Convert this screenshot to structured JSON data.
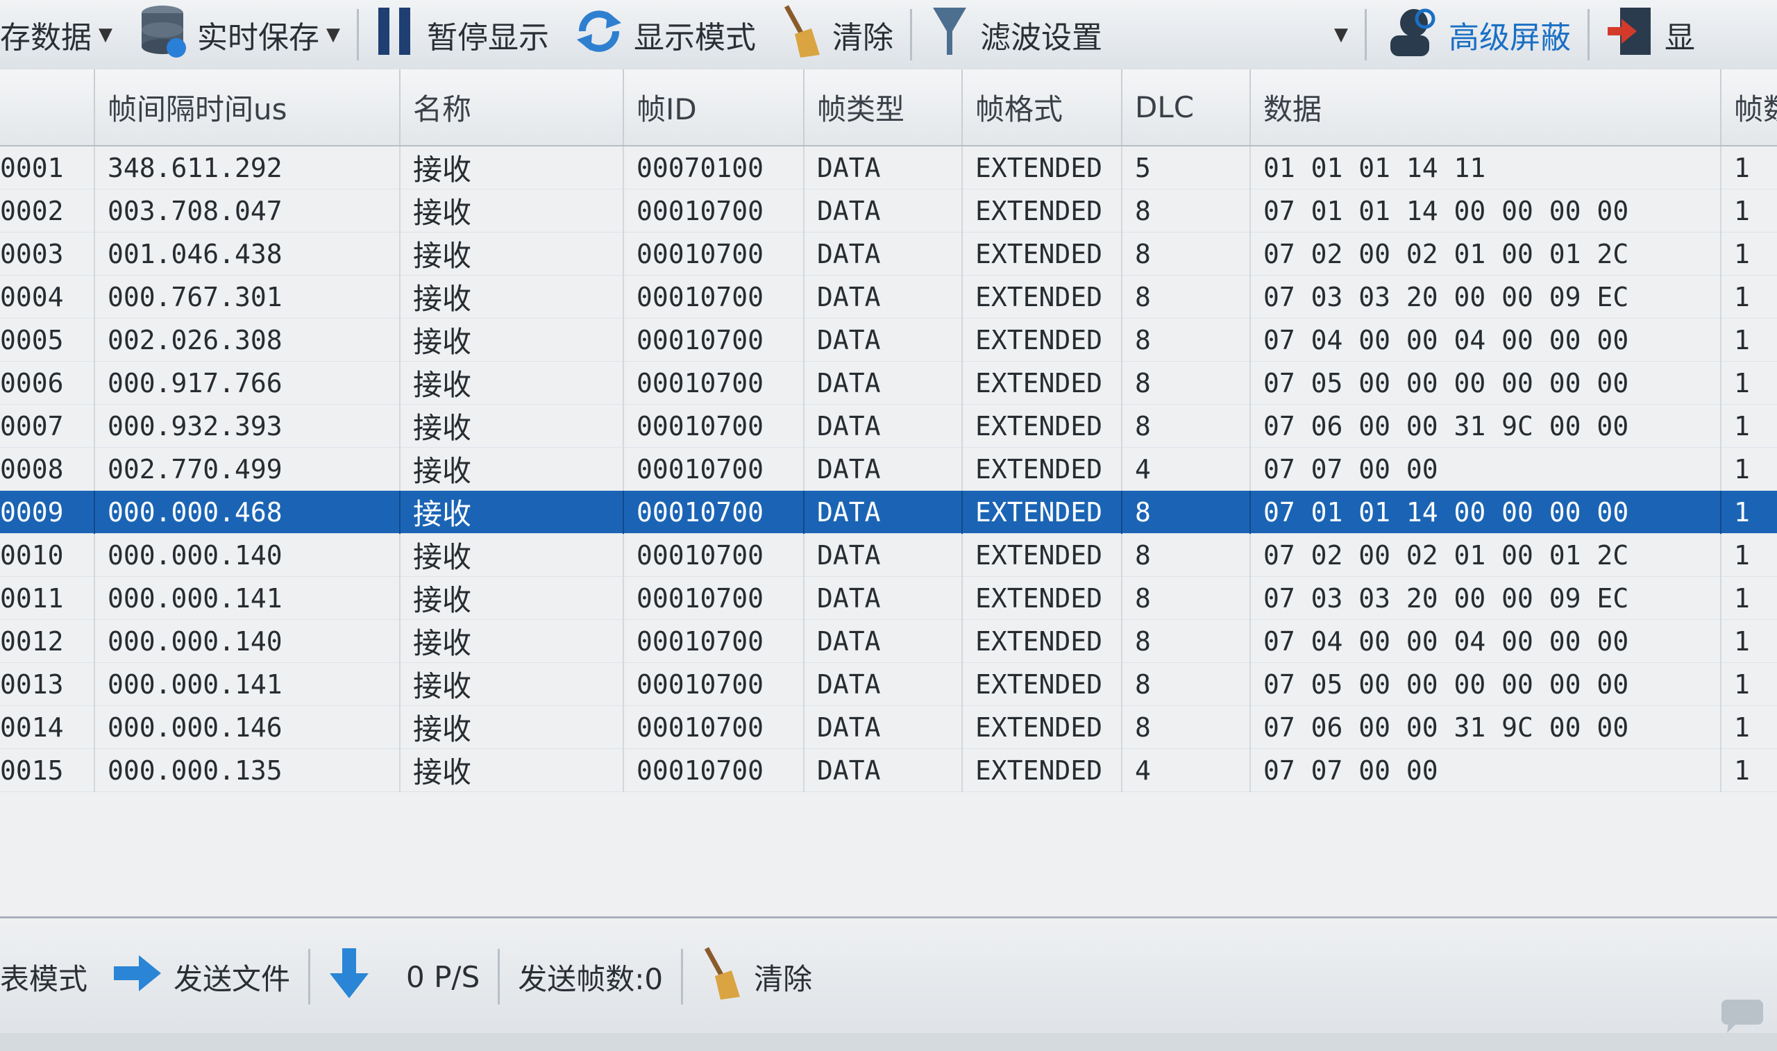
{
  "toolbar": {
    "save_data": "存数据",
    "realtime_save": "实时保存",
    "pause_display": "暂停显示",
    "display_mode": "显示模式",
    "clear": "清除",
    "filter_settings": "滤波设置",
    "advanced_mask": "高级屏蔽",
    "display_partial": "显"
  },
  "grid": {
    "columns": [
      "",
      "帧间隔时间us",
      "名称",
      "帧ID",
      "帧类型",
      "帧格式",
      "DLC",
      "数据",
      "帧数"
    ],
    "rows": [
      {
        "index": "0001",
        "interval": "348.611.292",
        "name": "接收",
        "frame_id": "00070100",
        "frame_type": "DATA",
        "frame_format": "EXTENDED",
        "dlc": "5",
        "data": "01 01 01 14 11",
        "last": "1"
      },
      {
        "index": "0002",
        "interval": "003.708.047",
        "name": "接收",
        "frame_id": "00010700",
        "frame_type": "DATA",
        "frame_format": "EXTENDED",
        "dlc": "8",
        "data": "07 01 01 14 00 00 00 00",
        "last": "1"
      },
      {
        "index": "0003",
        "interval": "001.046.438",
        "name": "接收",
        "frame_id": "00010700",
        "frame_type": "DATA",
        "frame_format": "EXTENDED",
        "dlc": "8",
        "data": "07 02 00 02 01 00 01 2C",
        "last": "1"
      },
      {
        "index": "0004",
        "interval": "000.767.301",
        "name": "接收",
        "frame_id": "00010700",
        "frame_type": "DATA",
        "frame_format": "EXTENDED",
        "dlc": "8",
        "data": "07 03 03 20 00 00 09 EC",
        "last": "1"
      },
      {
        "index": "0005",
        "interval": "002.026.308",
        "name": "接收",
        "frame_id": "00010700",
        "frame_type": "DATA",
        "frame_format": "EXTENDED",
        "dlc": "8",
        "data": "07 04 00 00 04 00 00 00",
        "last": "1"
      },
      {
        "index": "0006",
        "interval": "000.917.766",
        "name": "接收",
        "frame_id": "00010700",
        "frame_type": "DATA",
        "frame_format": "EXTENDED",
        "dlc": "8",
        "data": "07 05 00 00 00 00 00 00",
        "last": "1"
      },
      {
        "index": "0007",
        "interval": "000.932.393",
        "name": "接收",
        "frame_id": "00010700",
        "frame_type": "DATA",
        "frame_format": "EXTENDED",
        "dlc": "8",
        "data": "07 06 00 00 31 9C 00 00",
        "last": "1"
      },
      {
        "index": "0008",
        "interval": "002.770.499",
        "name": "接收",
        "frame_id": "00010700",
        "frame_type": "DATA",
        "frame_format": "EXTENDED",
        "dlc": "4",
        "data": "07 07 00 00",
        "last": "1"
      },
      {
        "index": "0009",
        "interval": "000.000.468",
        "name": "接收",
        "frame_id": "00010700",
        "frame_type": "DATA",
        "frame_format": "EXTENDED",
        "dlc": "8",
        "data": "07 01 01 14 00 00 00 00",
        "last": "1"
      },
      {
        "index": "0010",
        "interval": "000.000.140",
        "name": "接收",
        "frame_id": "00010700",
        "frame_type": "DATA",
        "frame_format": "EXTENDED",
        "dlc": "8",
        "data": "07 02 00 02 01 00 01 2C",
        "last": "1"
      },
      {
        "index": "0011",
        "interval": "000.000.141",
        "name": "接收",
        "frame_id": "00010700",
        "frame_type": "DATA",
        "frame_format": "EXTENDED",
        "dlc": "8",
        "data": "07 03 03 20 00 00 09 EC",
        "last": "1"
      },
      {
        "index": "0012",
        "interval": "000.000.140",
        "name": "接收",
        "frame_id": "00010700",
        "frame_type": "DATA",
        "frame_format": "EXTENDED",
        "dlc": "8",
        "data": "07 04 00 00 04 00 00 00",
        "last": "1"
      },
      {
        "index": "0013",
        "interval": "000.000.141",
        "name": "接收",
        "frame_id": "00010700",
        "frame_type": "DATA",
        "frame_format": "EXTENDED",
        "dlc": "8",
        "data": "07 05 00 00 00 00 00 00",
        "last": "1"
      },
      {
        "index": "0014",
        "interval": "000.000.146",
        "name": "接收",
        "frame_id": "00010700",
        "frame_type": "DATA",
        "frame_format": "EXTENDED",
        "dlc": "8",
        "data": "07 06 00 00 31 9C 00 00",
        "last": "1"
      },
      {
        "index": "0015",
        "interval": "000.000.135",
        "name": "接收",
        "frame_id": "00010700",
        "frame_type": "DATA",
        "frame_format": "EXTENDED",
        "dlc": "4",
        "data": "07 07 00 00",
        "last": "1"
      }
    ],
    "selected_index": "0009",
    "selection_color": "#1b64b5"
  },
  "bottombar": {
    "list_mode": "表模式",
    "send_file": "发送文件",
    "rate": "0 P/S",
    "sent_frames": "发送帧数:0",
    "clear": "清除"
  },
  "icons": [
    "database-icon",
    "pause-icon",
    "refresh-icon",
    "broom-icon",
    "filter-icon",
    "search-person-icon",
    "exit-icon",
    "arrow-right-icon",
    "arrow-down-icon",
    "chat-icon"
  ]
}
